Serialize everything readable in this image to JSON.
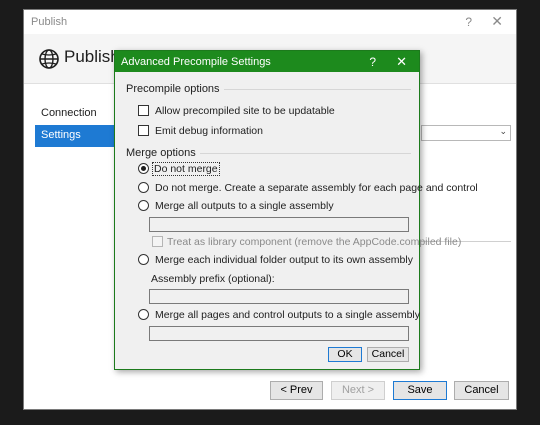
{
  "publish_window": {
    "title": "Publish",
    "help_glyph": "?",
    "close_glyph": "✕",
    "header_title": "Publish",
    "header_icon": "globe-icon",
    "sidebar": [
      {
        "label": "Connection",
        "selected": false
      },
      {
        "label": "Settings",
        "selected": true
      }
    ],
    "buttons": {
      "prev": "< Prev",
      "next": "Next >",
      "save": "Save",
      "cancel": "Cancel"
    }
  },
  "dialog": {
    "title": "Advanced Precompile Settings",
    "help_glyph": "?",
    "close_glyph": "✕",
    "accent_color": "#1d8a1d",
    "precompile_group": {
      "label": "Precompile options",
      "options": [
        {
          "label": "Allow precompiled site to be updatable",
          "checked": false
        },
        {
          "label": "Emit debug information",
          "checked": false
        }
      ]
    },
    "merge_group": {
      "label": "Merge options",
      "options": [
        {
          "label": "Do not merge",
          "selected": true
        },
        {
          "label": "Do not merge. Create a separate assembly for each page and control",
          "selected": false
        },
        {
          "label": "Merge all outputs to a single assembly",
          "selected": false
        },
        {
          "label": "Merge each individual folder output to its own assembly",
          "selected": false
        },
        {
          "label": "Merge all pages and control outputs to a single assembly",
          "selected": false
        }
      ],
      "library_checkbox": {
        "label": "Treat as library component (remove the AppCode.compiled file)",
        "checked": false,
        "enabled": false
      },
      "assembly_prefix_label": "Assembly prefix (optional):",
      "single_assembly_value": "",
      "assembly_prefix_value": "",
      "pages_assembly_value": ""
    },
    "ok_label": "OK",
    "cancel_label": "Cancel"
  }
}
